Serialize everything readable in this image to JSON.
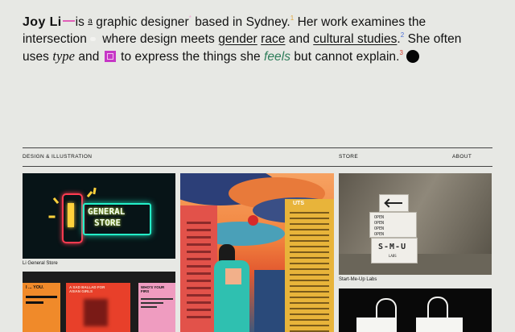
{
  "intro": {
    "name": "Joy Li",
    "p1": "is ",
    "a_glyph": "a",
    "p2": " graphic designer",
    "sup_star": "*",
    "p3": " based in Sydney.",
    "sup1": "1",
    "p4": " Her work examines the intersection",
    "p5": " where design meets ",
    "link_gender": "gender",
    "p6": "  ",
    "link_race": "race",
    "p7": " and ",
    "link_cultural": "cultural studies",
    "p8": ".",
    "sup2": "2",
    "p9": " She often uses ",
    "type_word": "type",
    "p10": " and ",
    "p11": " to express the things she ",
    "feels_word": "feels",
    "p12": " but cannot explain.",
    "sup3": "3"
  },
  "colors": {
    "background": "#e7e8e4",
    "accent_pink": "#e05fb8",
    "feels_green": "#2e7d5a",
    "magenta_square": "#c636c6"
  },
  "nav": {
    "left": "DESIGN & ILLUSTRATION",
    "store": "STORE",
    "about": "ABOUT"
  },
  "projects": [
    {
      "caption": "Li General Store",
      "sign_line1": "GENERAL",
      "sign_line2": "STORE"
    },
    {
      "poster1_line1": "I ... YOU.",
      "poster2_line1": "A SAD BALLAD FOR",
      "poster2_line2": "ASIAN GIRLS",
      "poster3_line1": "WHO'S YOUR FIRS"
    },
    {
      "label": "UTS"
    },
    {
      "caption": "Start-Me-Up Labs",
      "box_text": "OPEN",
      "logo_line1": "S-M-U",
      "logo_line2": "LABS"
    },
    {}
  ]
}
